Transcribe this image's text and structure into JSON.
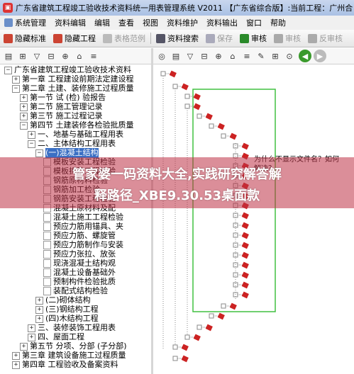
{
  "window": {
    "title": "广东省建筑工程竣工验收技术资料统一用表管理系统 V2011 【广东省综合版】:当前工程：广州合"
  },
  "menu": [
    "系统管理",
    "资料编辑",
    "编辑",
    "查看",
    "视图",
    "资料维护",
    "资料输出",
    "窗口",
    "帮助"
  ],
  "toolbar": {
    "hide_std": "隐藏标准",
    "hide_proj": "隐藏工程",
    "form_example": "表格范例",
    "search": "资料搜索",
    "save": "保存",
    "review": "审核",
    "approve": "审核",
    "unreview": "反审核"
  },
  "tree": [
    {
      "label": "广东省建筑工程竣工验收技术资料",
      "indent": 0,
      "box": "−"
    },
    {
      "label": "第一章  工程建设前期法定建设程",
      "indent": 1,
      "box": "+"
    },
    {
      "label": "第二章  土建、装修施工过程质量",
      "indent": 1,
      "box": "−"
    },
    {
      "label": "第一节  试 (检) 验报告",
      "indent": 2,
      "box": "+"
    },
    {
      "label": "第二节  施工管理记录",
      "indent": 2,
      "box": "+"
    },
    {
      "label": "第三节  施工过程记录",
      "indent": 2,
      "box": "+"
    },
    {
      "label": "第四节  土建装修各检验批质量",
      "indent": 2,
      "box": "−"
    },
    {
      "label": "一、地基与基础工程用表",
      "indent": 3,
      "box": "+"
    },
    {
      "label": "二、主体结构工程用表",
      "indent": 3,
      "box": "−"
    },
    {
      "label": "(一)混凝土结构",
      "indent": 4,
      "box": "−"
    },
    {
      "label": "模板安装工程检验",
      "indent": 5,
      "box": ""
    },
    {
      "label": "模板拆除工程检验",
      "indent": 5,
      "box": ""
    },
    {
      "label": "钢筋原材料检验",
      "indent": 5,
      "box": ""
    },
    {
      "label": "钢筋加工检验",
      "indent": 5,
      "box": ""
    },
    {
      "label": "钢筋安装工程检验",
      "indent": 5,
      "box": ""
    },
    {
      "label": "混凝土原材料及配",
      "indent": 5,
      "box": ""
    },
    {
      "label": "混凝土施工工程检验",
      "indent": 5,
      "box": ""
    },
    {
      "label": "预应力筋用锚具、夹",
      "indent": 5,
      "box": ""
    },
    {
      "label": "预应力筋、螺旋管",
      "indent": 5,
      "box": ""
    },
    {
      "label": "预应力筋制作与安装",
      "indent": 5,
      "box": ""
    },
    {
      "label": "预应力张拉、放张",
      "indent": 5,
      "box": ""
    },
    {
      "label": "现浇混凝土结构观",
      "indent": 5,
      "box": ""
    },
    {
      "label": "混凝土设备基础外",
      "indent": 5,
      "box": ""
    },
    {
      "label": "预制构件检验批质",
      "indent": 5,
      "box": ""
    },
    {
      "label": "装配式结构检验",
      "indent": 5,
      "box": ""
    },
    {
      "label": "(二)砌体结构",
      "indent": 4,
      "box": "+"
    },
    {
      "label": "(三)钢结构工程",
      "indent": 4,
      "box": "+"
    },
    {
      "label": "(四)木结构工程",
      "indent": 4,
      "box": "+"
    },
    {
      "label": "三、装修装饰工程用表",
      "indent": 3,
      "box": "+"
    },
    {
      "label": "四、屋面工程",
      "indent": 3,
      "box": "+"
    },
    {
      "label": "第五节  分项、分部 (子分部)",
      "indent": 2,
      "box": "+"
    },
    {
      "label": "第三章  建筑设备施工过程质量",
      "indent": 1,
      "box": "+"
    },
    {
      "label": "第四章  工程验收及备案资料",
      "indent": 1,
      "box": "+"
    }
  ],
  "note": "为什么不显示文件名？如何解决？",
  "banner": {
    "line1": "管家婆一码资料大全,实践研究解答解",
    "line2": "释路径_XBE9.30.53桌面款"
  },
  "colors": {
    "accent": "#3a6fc4",
    "frame": "#40c040",
    "node": "#cc2222"
  }
}
